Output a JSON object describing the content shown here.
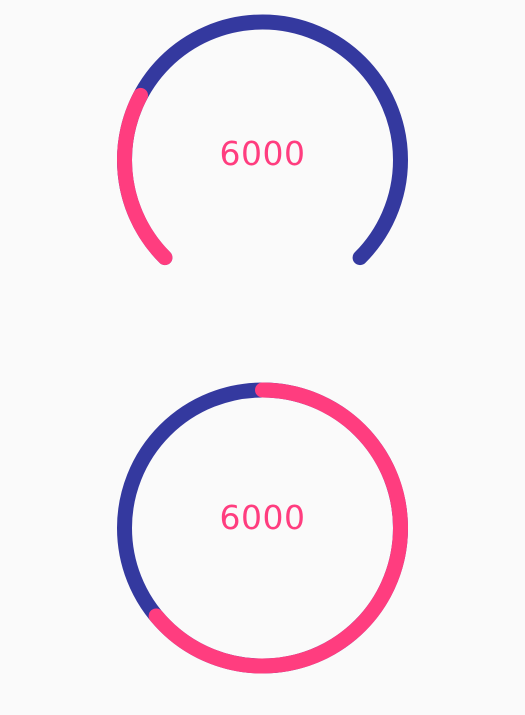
{
  "gauges": [
    {
      "value_text": "6000",
      "progress": 0.27,
      "variant": "arc",
      "sweep_degrees": 270
    },
    {
      "value_text": "6000",
      "progress": 0.64,
      "variant": "ring",
      "sweep_degrees": 360
    }
  ],
  "colors": {
    "background": "#fafafa",
    "track": "#34399f",
    "progress": "#ff3d7f",
    "value_text": "#ff3d7f"
  }
}
